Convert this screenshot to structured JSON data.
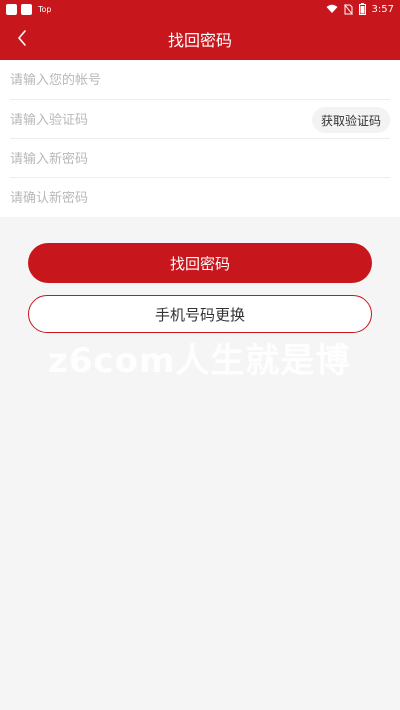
{
  "status_bar": {
    "app_label": "Top",
    "time": "3:57"
  },
  "header": {
    "title": "找回密码",
    "back_icon": "chevron-left-icon"
  },
  "form": {
    "account_placeholder": "请输入您的帐号",
    "code_placeholder": "请输入验证码",
    "get_code_label": "获取验证码",
    "new_password_placeholder": "请输入新密码",
    "confirm_password_placeholder": "请确认新密码"
  },
  "actions": {
    "recover_label": "找回密码",
    "change_phone_label": "手机号码更换"
  },
  "watermark": "z6com人生就是博",
  "colors": {
    "primary": "#c8161d",
    "background": "#f5f5f5"
  }
}
